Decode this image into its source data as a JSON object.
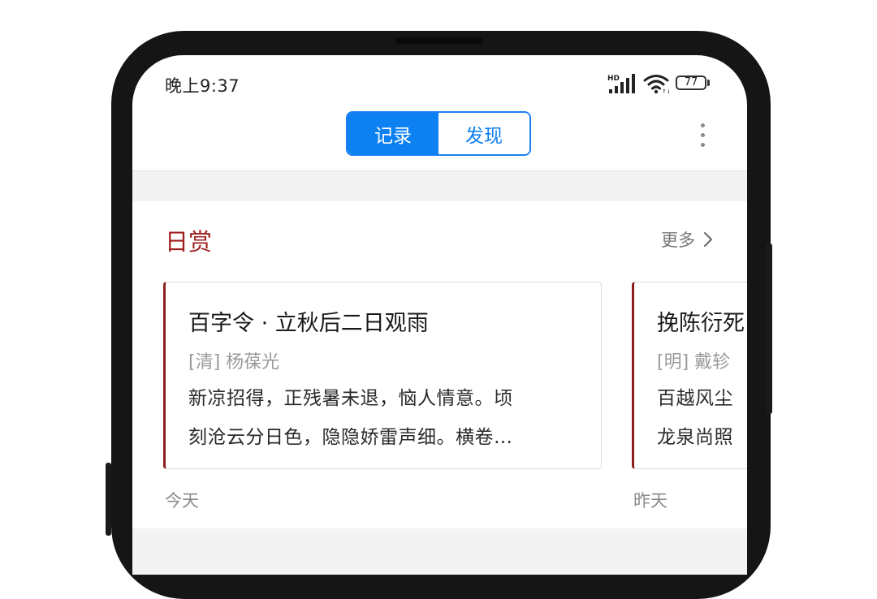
{
  "status_bar": {
    "time": "晚上9:37",
    "battery": "77",
    "network_badge": "HD",
    "icons": [
      "signal-icon",
      "wifi-icon",
      "battery-icon"
    ]
  },
  "header": {
    "tabs": [
      {
        "label": "记录",
        "active": true
      },
      {
        "label": "发现",
        "active": false
      }
    ],
    "menu_icon": "more-vertical-icon"
  },
  "section": {
    "title": "日赏",
    "more_label": "更多",
    "more_icon": "chevron-right-icon"
  },
  "cards": [
    {
      "title": "百字令 · 立秋后二日观雨",
      "author": "[清] 杨葆光",
      "line1": "新凉招得，正残暑未退，恼人情意。顷",
      "line2": "刻沧云分日色，隐隐娇雷声细。横卷…",
      "day": "今天"
    },
    {
      "title": "挽陈衍死",
      "author": "[明] 戴轸",
      "line1": "百越风尘",
      "line2": "龙泉尚照",
      "day": "昨天"
    }
  ],
  "colors": {
    "accent_blue": "#0d80f2",
    "section_red": "#a11f1f",
    "card_border_red": "#8f1e1e"
  }
}
